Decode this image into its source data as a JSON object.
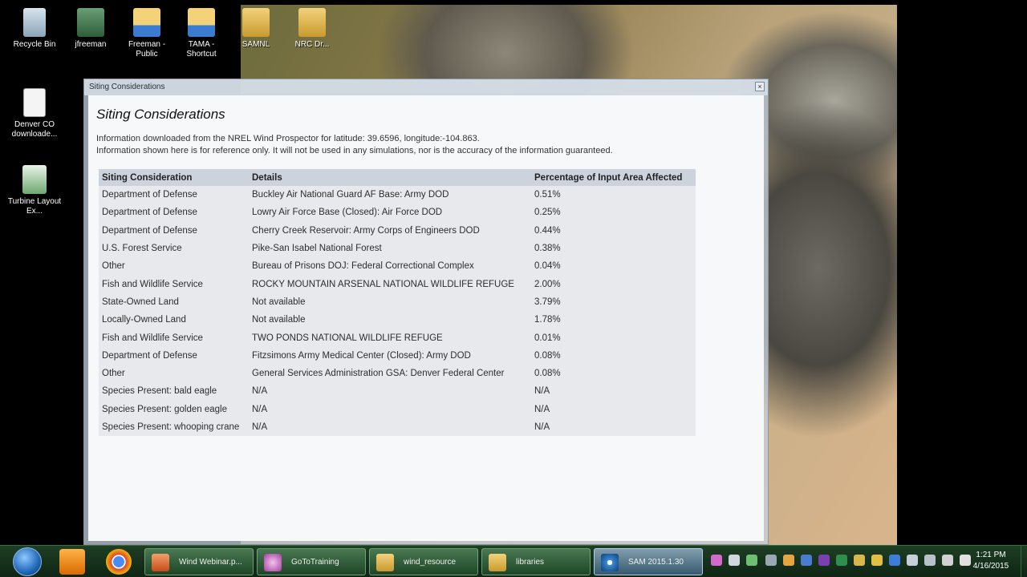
{
  "desktop_icons": [
    {
      "label": "Recycle Bin",
      "icon": "recycle-bin-icon"
    },
    {
      "label": "jfreeman",
      "icon": "user-folder-icon"
    },
    {
      "label": "Freeman - Public",
      "icon": "folder-shortcut-icon"
    },
    {
      "label": "TAMA - Shortcut",
      "icon": "folder-shortcut-icon"
    },
    {
      "label": "SAMNL",
      "icon": "folder-icon"
    },
    {
      "label": "NRC Dr...",
      "icon": "folder-icon"
    },
    {
      "label": "Denver CO downloade...",
      "icon": "document-icon"
    },
    {
      "label": "Turbine Layout Ex...",
      "icon": "spreadsheet-icon"
    }
  ],
  "dialog": {
    "title": "Siting Considerations",
    "heading": "Siting Considerations",
    "info_line1": "Information downloaded from the NREL Wind Prospector for latitude: 39.6596, longitude:-104.863.",
    "info_line2": "Information shown here is for reference only. It will not be used in any simulations, nor is the accuracy of the information guaranteed.",
    "close_glyph": "×",
    "table": {
      "headers": [
        "Siting Consideration",
        "Details",
        "Percentage of Input Area Affected"
      ],
      "rows": [
        [
          "Department of Defense",
          "Buckley Air National Guard AF Base: Army DOD",
          "0.51%"
        ],
        [
          "Department of Defense",
          "Lowry Air Force Base (Closed): Air Force DOD",
          "0.25%"
        ],
        [
          "Department of Defense",
          "Cherry Creek Reservoir: Army Corps of Engineers DOD",
          "0.44%"
        ],
        [
          "U.S. Forest Service",
          "Pike-San Isabel National Forest",
          "0.38%"
        ],
        [
          "Other",
          "Bureau of Prisons DOJ: Federal Correctional Complex",
          "0.04%"
        ],
        [
          "Fish and Wildlife Service",
          "ROCKY MOUNTAIN ARSENAL NATIONAL WILDLIFE REFUGE",
          "2.00%"
        ],
        [
          "State-Owned Land",
          "Not available",
          "3.79%"
        ],
        [
          "Locally-Owned Land",
          "Not available",
          "1.78%"
        ],
        [
          "Fish and Wildlife Service",
          "TWO PONDS NATIONAL WILDLIFE REFUGE",
          "0.01%"
        ],
        [
          "Department of Defense",
          "Fitzsimons Army Medical Center (Closed): Army DOD",
          "0.08%"
        ],
        [
          "Other",
          "General Services Administration GSA: Denver Federal Center",
          "0.08%"
        ],
        [
          "Species Present: bald eagle",
          "N/A",
          "N/A"
        ],
        [
          "Species Present: golden eagle",
          "N/A",
          "N/A"
        ],
        [
          "Species Present: whooping crane",
          "N/A",
          "N/A"
        ]
      ]
    }
  },
  "taskbar": {
    "tasks": [
      {
        "label": "Wind Webinar.p...",
        "icon": "powerpoint-icon"
      },
      {
        "label": "GoToTraining",
        "icon": "gototraining-icon"
      },
      {
        "label": "wind_resource",
        "icon": "folder-icon"
      },
      {
        "label": "libraries",
        "icon": "folder-icon"
      },
      {
        "label": "SAM 2015.1.30",
        "icon": "sam-icon"
      }
    ],
    "clock_time": "1:21 PM",
    "clock_date": "4/16/2015"
  },
  "colors": {
    "taskbar": "#1e3f24",
    "dialog_body": "#f7f8fa",
    "table_header": "#cdd3dc",
    "table_row": "#e7e9ec"
  }
}
